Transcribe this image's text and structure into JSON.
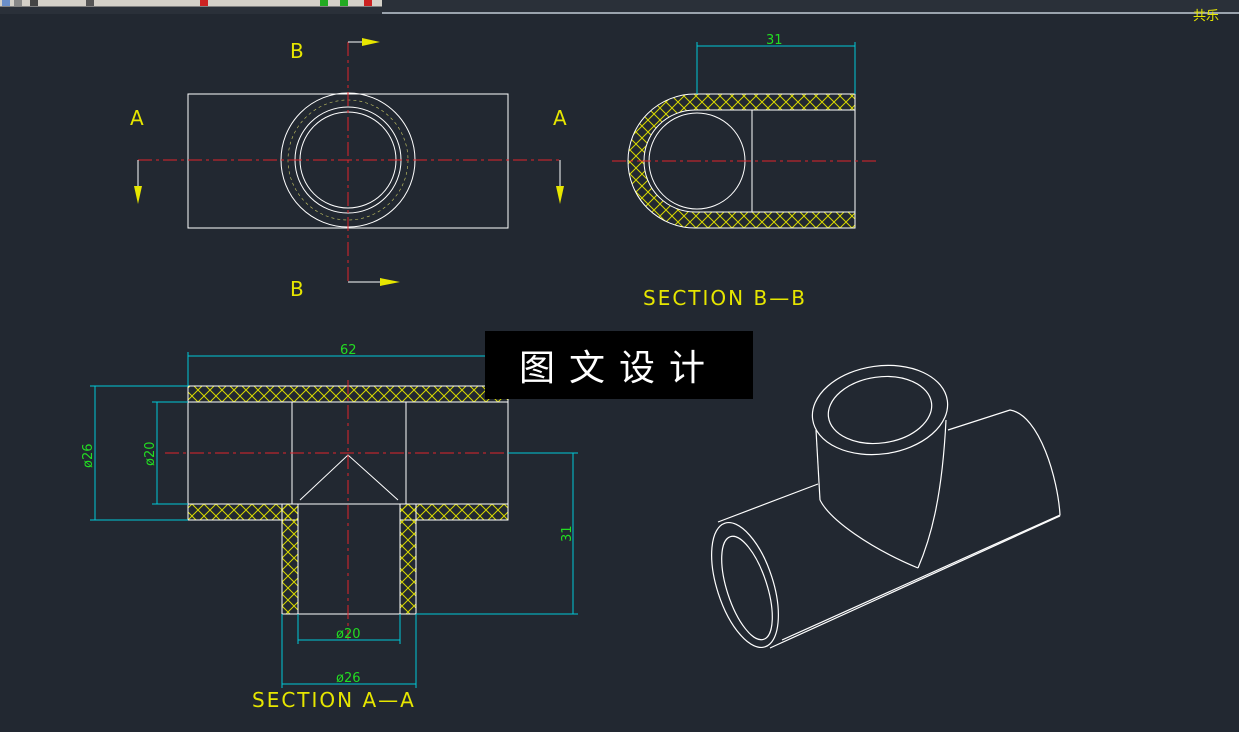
{
  "corner_label": "共乐",
  "watermark": "图文设计",
  "top_view": {
    "label_a_left": "A",
    "label_a_right": "A",
    "label_b_top": "B",
    "label_b_bottom": "B"
  },
  "section_bb": {
    "title": "SECTION B—B",
    "dim_31": "31"
  },
  "section_aa": {
    "title": "SECTION A—A",
    "dim_62": "62",
    "dim_d26_left": "ø26",
    "dim_d20_left": "ø20",
    "dim_31": "31",
    "dim_d20_bottom": "ø20",
    "dim_d26_bottom": "ø26"
  },
  "colors": {
    "background": "#222831",
    "outline": "#ffffff",
    "center_line": "#e0242b",
    "label": "#e6e600",
    "dimension": "#00c8d7",
    "dim_text": "#22dd22",
    "hatch": "#d8d800"
  }
}
